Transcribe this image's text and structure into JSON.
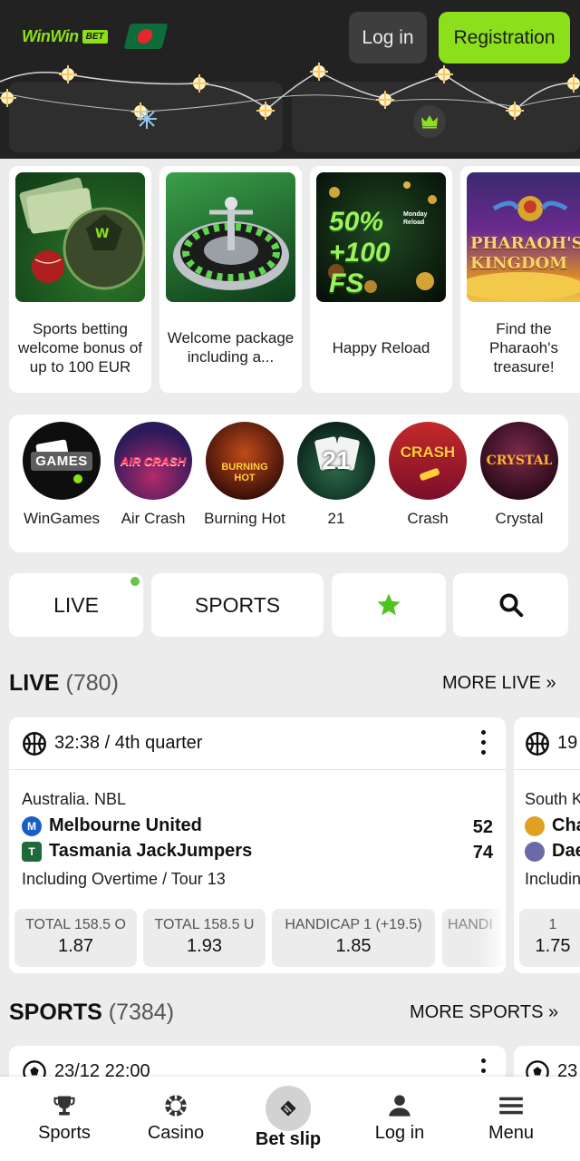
{
  "header": {
    "logo_text": "WinWin",
    "logo_badge": "BET",
    "login_label": "Log in",
    "register_label": "Registration",
    "colors": {
      "brand": "#8be01b",
      "header_bg": "#222222"
    }
  },
  "promotions": [
    {
      "text": "Sports betting welcome bonus of up to 100 EUR",
      "image": "money-ball-icon"
    },
    {
      "text": "Welcome package including a...",
      "image": "roulette-icon"
    },
    {
      "text": "Happy Reload",
      "image_text": "50% +100 FS",
      "image_badge": "Monday Reload"
    },
    {
      "text": "Find the Pharaoh's treasure!",
      "image_text": "PHARAOH'S KINGDOM"
    }
  ],
  "games": [
    {
      "label": "WinGames",
      "badge": "GAMES"
    },
    {
      "label": "Air Crash",
      "badge": "AIR CRASH"
    },
    {
      "label": "Burning Hot",
      "badge": "BURNING HOT"
    },
    {
      "label": "21",
      "badge": "21"
    },
    {
      "label": "Crash",
      "badge": "CRASH"
    },
    {
      "label": "Crystal",
      "badge": "CRYSTAL"
    }
  ],
  "tabs": {
    "live": "LIVE",
    "sports": "SPORTS",
    "favorites_icon": "star-icon",
    "search_icon": "search-icon"
  },
  "live_section": {
    "title": "LIVE",
    "count": "(780)",
    "more": "MORE LIVE"
  },
  "live_event": {
    "time": "32:38 / 4th quarter",
    "league": "Australia. NBL",
    "team1": "Melbourne United",
    "team2": "Tasmania JackJumpers",
    "score1": "52",
    "score2": "74",
    "note": "Including Overtime / Tour 13",
    "odds": [
      {
        "name": "TOTAL 158.5 O",
        "value": "1.87"
      },
      {
        "name": "TOTAL 158.5 U",
        "value": "1.93"
      },
      {
        "name": "HANDICAP 1 (+19.5)",
        "value": "1.85"
      },
      {
        "name": "HANDI",
        "value": ""
      }
    ]
  },
  "live_event_2": {
    "time": "19",
    "league": "South K",
    "team1": "Cha",
    "team2": "Dae",
    "note": "Includin",
    "odd_name": "1",
    "odd_value": "1.75"
  },
  "sports_section": {
    "title": "SPORTS",
    "count": "(7384)",
    "more": "MORE SPORTS"
  },
  "sports_event": {
    "time": "23/12 22:00",
    "time2": "23"
  },
  "bottom_nav": {
    "sports": "Sports",
    "casino": "Casino",
    "betslip": "Bet slip",
    "login": "Log in",
    "menu": "Menu"
  }
}
